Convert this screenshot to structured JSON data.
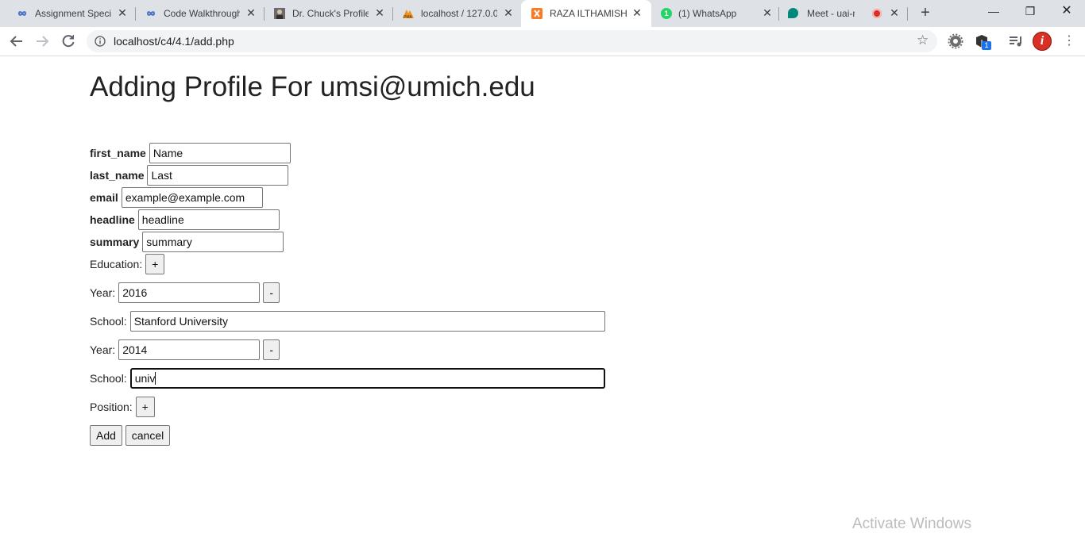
{
  "browser": {
    "tabs": [
      {
        "title": "Assignment Specif",
        "icon": "infinity-icon",
        "active": false
      },
      {
        "title": "Code Walkthrough",
        "icon": "infinity-icon",
        "active": false
      },
      {
        "title": "Dr. Chuck's Profile",
        "icon": "portrait-icon",
        "active": false
      },
      {
        "title": "localhost / 127.0.0",
        "icon": "phpmyadmin-icon",
        "active": false
      },
      {
        "title": "RAZA ILTHAMISH",
        "icon": "xampp-icon",
        "active": true
      },
      {
        "title": "(1) WhatsApp",
        "icon": "whatsapp-icon",
        "badge": "1",
        "active": false
      },
      {
        "title": "Meet - uai-nro",
        "icon": "meet-icon",
        "active": false
      }
    ],
    "close_glyph": "✕",
    "new_tab_glyph": "+",
    "window": {
      "minimize": "—",
      "maximize": "❐",
      "close": "✕"
    },
    "address": "localhost/c4/4.1/add.php",
    "extension_badge": "1",
    "colors": {
      "whatsapp": "#25d366",
      "meet": "#00897b",
      "record": "#d93025",
      "phpmyadmin": "#f29111",
      "xampp": "#fb7a24",
      "chrome_accent": "#1a73e8"
    }
  },
  "page": {
    "title": "Adding Profile For umsi@umich.edu",
    "fields": {
      "first_name": {
        "label": "first_name",
        "value": "Name"
      },
      "last_name": {
        "label": "last_name",
        "value": "Last"
      },
      "email": {
        "label": "email",
        "value": "example@example.com"
      },
      "headline": {
        "label": "headline",
        "value": "headline"
      },
      "summary": {
        "label": "summary",
        "value": "summary"
      }
    },
    "education_label": "Education:",
    "plus": "+",
    "minus": "-",
    "year_label": "Year:",
    "school_label": "School:",
    "education": [
      {
        "year": "2016",
        "school": "Stanford University"
      },
      {
        "year": "2014",
        "school": "univ"
      }
    ],
    "position_label": "Position:",
    "add_label": "Add",
    "cancel_label": "cancel"
  },
  "watermark": "Activate Windows"
}
